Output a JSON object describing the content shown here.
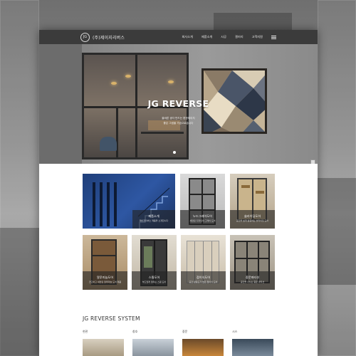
{
  "header": {
    "logo_mark": "JG",
    "company_name": "(주)제이지리버스",
    "nav": [
      "회사소개",
      "제품소개",
      "시공",
      "갤러리",
      "고객지원"
    ]
  },
  "hero": {
    "title": "JG REVERSE",
    "subtitle_line1": "올바른 생각 만드는 편한제이지",
    "subtitle_line2": "좋은 그림을 가슴으로습니다"
  },
  "products": [
    {
      "title": "제품소개",
      "desc": "제이지리버스 제품을 소개합니다"
    },
    {
      "title": "누드그레이도어",
      "desc": "세련된 디자인의 그레이 도어"
    },
    {
      "title": "슬라이딩도어",
      "desc": "공간을 넓게 활용하는 슬라이딩 도어"
    },
    {
      "title": "알루미늄도어",
      "desc": "견고하고 세련된 알루미늄 도어 제품"
    },
    {
      "title": "스윙도어",
      "desc": "부드럽게 열리는 스윙 도어"
    },
    {
      "title": "접이식도어",
      "desc": "공간 활용도가 높은 접이식 도어"
    },
    {
      "title": "중문파티션",
      "desc": "공간을 나누는 중문 파티션"
    }
  ],
  "system": {
    "title": "JG REVERSE SYSTEM",
    "labels": [
      "현관",
      "창호",
      "중문",
      "시스"
    ]
  },
  "colors": {
    "header_bg": "#3b3b3b",
    "accent_blue": "#2e4f8c",
    "caption_overlay": "#232323"
  }
}
